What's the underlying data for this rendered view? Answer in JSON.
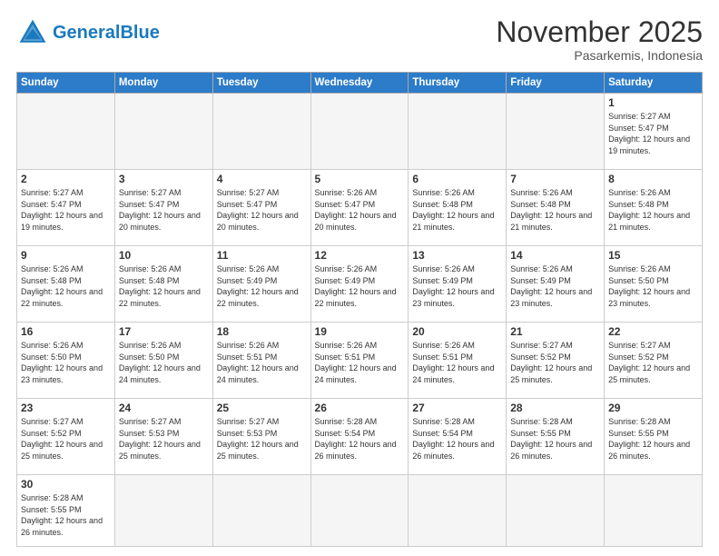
{
  "header": {
    "logo_general": "General",
    "logo_blue": "Blue",
    "month_title": "November 2025",
    "location": "Pasarkemis, Indonesia"
  },
  "weekdays": [
    "Sunday",
    "Monday",
    "Tuesday",
    "Wednesday",
    "Thursday",
    "Friday",
    "Saturday"
  ],
  "days": {
    "d1": {
      "num": "1",
      "sunrise": "5:27 AM",
      "sunset": "5:47 PM",
      "daylight": "12 hours and 19 minutes."
    },
    "d2": {
      "num": "2",
      "sunrise": "5:27 AM",
      "sunset": "5:47 PM",
      "daylight": "12 hours and 19 minutes."
    },
    "d3": {
      "num": "3",
      "sunrise": "5:27 AM",
      "sunset": "5:47 PM",
      "daylight": "12 hours and 20 minutes."
    },
    "d4": {
      "num": "4",
      "sunrise": "5:27 AM",
      "sunset": "5:47 PM",
      "daylight": "12 hours and 20 minutes."
    },
    "d5": {
      "num": "5",
      "sunrise": "5:26 AM",
      "sunset": "5:47 PM",
      "daylight": "12 hours and 20 minutes."
    },
    "d6": {
      "num": "6",
      "sunrise": "5:26 AM",
      "sunset": "5:48 PM",
      "daylight": "12 hours and 21 minutes."
    },
    "d7": {
      "num": "7",
      "sunrise": "5:26 AM",
      "sunset": "5:48 PM",
      "daylight": "12 hours and 21 minutes."
    },
    "d8": {
      "num": "8",
      "sunrise": "5:26 AM",
      "sunset": "5:48 PM",
      "daylight": "12 hours and 21 minutes."
    },
    "d9": {
      "num": "9",
      "sunrise": "5:26 AM",
      "sunset": "5:48 PM",
      "daylight": "12 hours and 22 minutes."
    },
    "d10": {
      "num": "10",
      "sunrise": "5:26 AM",
      "sunset": "5:48 PM",
      "daylight": "12 hours and 22 minutes."
    },
    "d11": {
      "num": "11",
      "sunrise": "5:26 AM",
      "sunset": "5:49 PM",
      "daylight": "12 hours and 22 minutes."
    },
    "d12": {
      "num": "12",
      "sunrise": "5:26 AM",
      "sunset": "5:49 PM",
      "daylight": "12 hours and 22 minutes."
    },
    "d13": {
      "num": "13",
      "sunrise": "5:26 AM",
      "sunset": "5:49 PM",
      "daylight": "12 hours and 23 minutes."
    },
    "d14": {
      "num": "14",
      "sunrise": "5:26 AM",
      "sunset": "5:49 PM",
      "daylight": "12 hours and 23 minutes."
    },
    "d15": {
      "num": "15",
      "sunrise": "5:26 AM",
      "sunset": "5:50 PM",
      "daylight": "12 hours and 23 minutes."
    },
    "d16": {
      "num": "16",
      "sunrise": "5:26 AM",
      "sunset": "5:50 PM",
      "daylight": "12 hours and 23 minutes."
    },
    "d17": {
      "num": "17",
      "sunrise": "5:26 AM",
      "sunset": "5:50 PM",
      "daylight": "12 hours and 24 minutes."
    },
    "d18": {
      "num": "18",
      "sunrise": "5:26 AM",
      "sunset": "5:51 PM",
      "daylight": "12 hours and 24 minutes."
    },
    "d19": {
      "num": "19",
      "sunrise": "5:26 AM",
      "sunset": "5:51 PM",
      "daylight": "12 hours and 24 minutes."
    },
    "d20": {
      "num": "20",
      "sunrise": "5:26 AM",
      "sunset": "5:51 PM",
      "daylight": "12 hours and 24 minutes."
    },
    "d21": {
      "num": "21",
      "sunrise": "5:27 AM",
      "sunset": "5:52 PM",
      "daylight": "12 hours and 25 minutes."
    },
    "d22": {
      "num": "22",
      "sunrise": "5:27 AM",
      "sunset": "5:52 PM",
      "daylight": "12 hours and 25 minutes."
    },
    "d23": {
      "num": "23",
      "sunrise": "5:27 AM",
      "sunset": "5:52 PM",
      "daylight": "12 hours and 25 minutes."
    },
    "d24": {
      "num": "24",
      "sunrise": "5:27 AM",
      "sunset": "5:53 PM",
      "daylight": "12 hours and 25 minutes."
    },
    "d25": {
      "num": "25",
      "sunrise": "5:27 AM",
      "sunset": "5:53 PM",
      "daylight": "12 hours and 25 minutes."
    },
    "d26": {
      "num": "26",
      "sunrise": "5:28 AM",
      "sunset": "5:54 PM",
      "daylight": "12 hours and 26 minutes."
    },
    "d27": {
      "num": "27",
      "sunrise": "5:28 AM",
      "sunset": "5:54 PM",
      "daylight": "12 hours and 26 minutes."
    },
    "d28": {
      "num": "28",
      "sunrise": "5:28 AM",
      "sunset": "5:55 PM",
      "daylight": "12 hours and 26 minutes."
    },
    "d29": {
      "num": "29",
      "sunrise": "5:28 AM",
      "sunset": "5:55 PM",
      "daylight": "12 hours and 26 minutes."
    },
    "d30": {
      "num": "30",
      "sunrise": "5:28 AM",
      "sunset": "5:55 PM",
      "daylight": "12 hours and 26 minutes."
    }
  }
}
